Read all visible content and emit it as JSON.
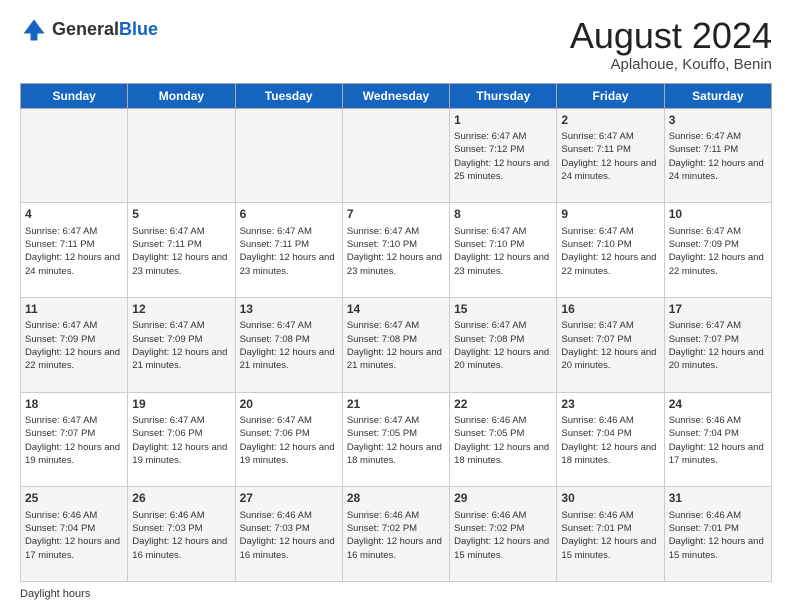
{
  "header": {
    "logo_line1": "General",
    "logo_line2": "Blue",
    "month_year": "August 2024",
    "location": "Aplahoue, Kouffo, Benin"
  },
  "days_of_week": [
    "Sunday",
    "Monday",
    "Tuesday",
    "Wednesday",
    "Thursday",
    "Friday",
    "Saturday"
  ],
  "weeks": [
    [
      {
        "day": "",
        "info": ""
      },
      {
        "day": "",
        "info": ""
      },
      {
        "day": "",
        "info": ""
      },
      {
        "day": "",
        "info": ""
      },
      {
        "day": "1",
        "info": "Sunrise: 6:47 AM\nSunset: 7:12 PM\nDaylight: 12 hours\nand 25 minutes."
      },
      {
        "day": "2",
        "info": "Sunrise: 6:47 AM\nSunset: 7:11 PM\nDaylight: 12 hours\nand 24 minutes."
      },
      {
        "day": "3",
        "info": "Sunrise: 6:47 AM\nSunset: 7:11 PM\nDaylight: 12 hours\nand 24 minutes."
      }
    ],
    [
      {
        "day": "4",
        "info": "Sunrise: 6:47 AM\nSunset: 7:11 PM\nDaylight: 12 hours\nand 24 minutes."
      },
      {
        "day": "5",
        "info": "Sunrise: 6:47 AM\nSunset: 7:11 PM\nDaylight: 12 hours\nand 23 minutes."
      },
      {
        "day": "6",
        "info": "Sunrise: 6:47 AM\nSunset: 7:11 PM\nDaylight: 12 hours\nand 23 minutes."
      },
      {
        "day": "7",
        "info": "Sunrise: 6:47 AM\nSunset: 7:10 PM\nDaylight: 12 hours\nand 23 minutes."
      },
      {
        "day": "8",
        "info": "Sunrise: 6:47 AM\nSunset: 7:10 PM\nDaylight: 12 hours\nand 23 minutes."
      },
      {
        "day": "9",
        "info": "Sunrise: 6:47 AM\nSunset: 7:10 PM\nDaylight: 12 hours\nand 22 minutes."
      },
      {
        "day": "10",
        "info": "Sunrise: 6:47 AM\nSunset: 7:09 PM\nDaylight: 12 hours\nand 22 minutes."
      }
    ],
    [
      {
        "day": "11",
        "info": "Sunrise: 6:47 AM\nSunset: 7:09 PM\nDaylight: 12 hours\nand 22 minutes."
      },
      {
        "day": "12",
        "info": "Sunrise: 6:47 AM\nSunset: 7:09 PM\nDaylight: 12 hours\nand 21 minutes."
      },
      {
        "day": "13",
        "info": "Sunrise: 6:47 AM\nSunset: 7:08 PM\nDaylight: 12 hours\nand 21 minutes."
      },
      {
        "day": "14",
        "info": "Sunrise: 6:47 AM\nSunset: 7:08 PM\nDaylight: 12 hours\nand 21 minutes."
      },
      {
        "day": "15",
        "info": "Sunrise: 6:47 AM\nSunset: 7:08 PM\nDaylight: 12 hours\nand 20 minutes."
      },
      {
        "day": "16",
        "info": "Sunrise: 6:47 AM\nSunset: 7:07 PM\nDaylight: 12 hours\nand 20 minutes."
      },
      {
        "day": "17",
        "info": "Sunrise: 6:47 AM\nSunset: 7:07 PM\nDaylight: 12 hours\nand 20 minutes."
      }
    ],
    [
      {
        "day": "18",
        "info": "Sunrise: 6:47 AM\nSunset: 7:07 PM\nDaylight: 12 hours\nand 19 minutes."
      },
      {
        "day": "19",
        "info": "Sunrise: 6:47 AM\nSunset: 7:06 PM\nDaylight: 12 hours\nand 19 minutes."
      },
      {
        "day": "20",
        "info": "Sunrise: 6:47 AM\nSunset: 7:06 PM\nDaylight: 12 hours\nand 19 minutes."
      },
      {
        "day": "21",
        "info": "Sunrise: 6:47 AM\nSunset: 7:05 PM\nDaylight: 12 hours\nand 18 minutes."
      },
      {
        "day": "22",
        "info": "Sunrise: 6:46 AM\nSunset: 7:05 PM\nDaylight: 12 hours\nand 18 minutes."
      },
      {
        "day": "23",
        "info": "Sunrise: 6:46 AM\nSunset: 7:04 PM\nDaylight: 12 hours\nand 18 minutes."
      },
      {
        "day": "24",
        "info": "Sunrise: 6:46 AM\nSunset: 7:04 PM\nDaylight: 12 hours\nand 17 minutes."
      }
    ],
    [
      {
        "day": "25",
        "info": "Sunrise: 6:46 AM\nSunset: 7:04 PM\nDaylight: 12 hours\nand 17 minutes."
      },
      {
        "day": "26",
        "info": "Sunrise: 6:46 AM\nSunset: 7:03 PM\nDaylight: 12 hours\nand 16 minutes."
      },
      {
        "day": "27",
        "info": "Sunrise: 6:46 AM\nSunset: 7:03 PM\nDaylight: 12 hours\nand 16 minutes."
      },
      {
        "day": "28",
        "info": "Sunrise: 6:46 AM\nSunset: 7:02 PM\nDaylight: 12 hours\nand 16 minutes."
      },
      {
        "day": "29",
        "info": "Sunrise: 6:46 AM\nSunset: 7:02 PM\nDaylight: 12 hours\nand 15 minutes."
      },
      {
        "day": "30",
        "info": "Sunrise: 6:46 AM\nSunset: 7:01 PM\nDaylight: 12 hours\nand 15 minutes."
      },
      {
        "day": "31",
        "info": "Sunrise: 6:46 AM\nSunset: 7:01 PM\nDaylight: 12 hours\nand 15 minutes."
      }
    ]
  ],
  "footer": {
    "label": "Daylight hours"
  }
}
